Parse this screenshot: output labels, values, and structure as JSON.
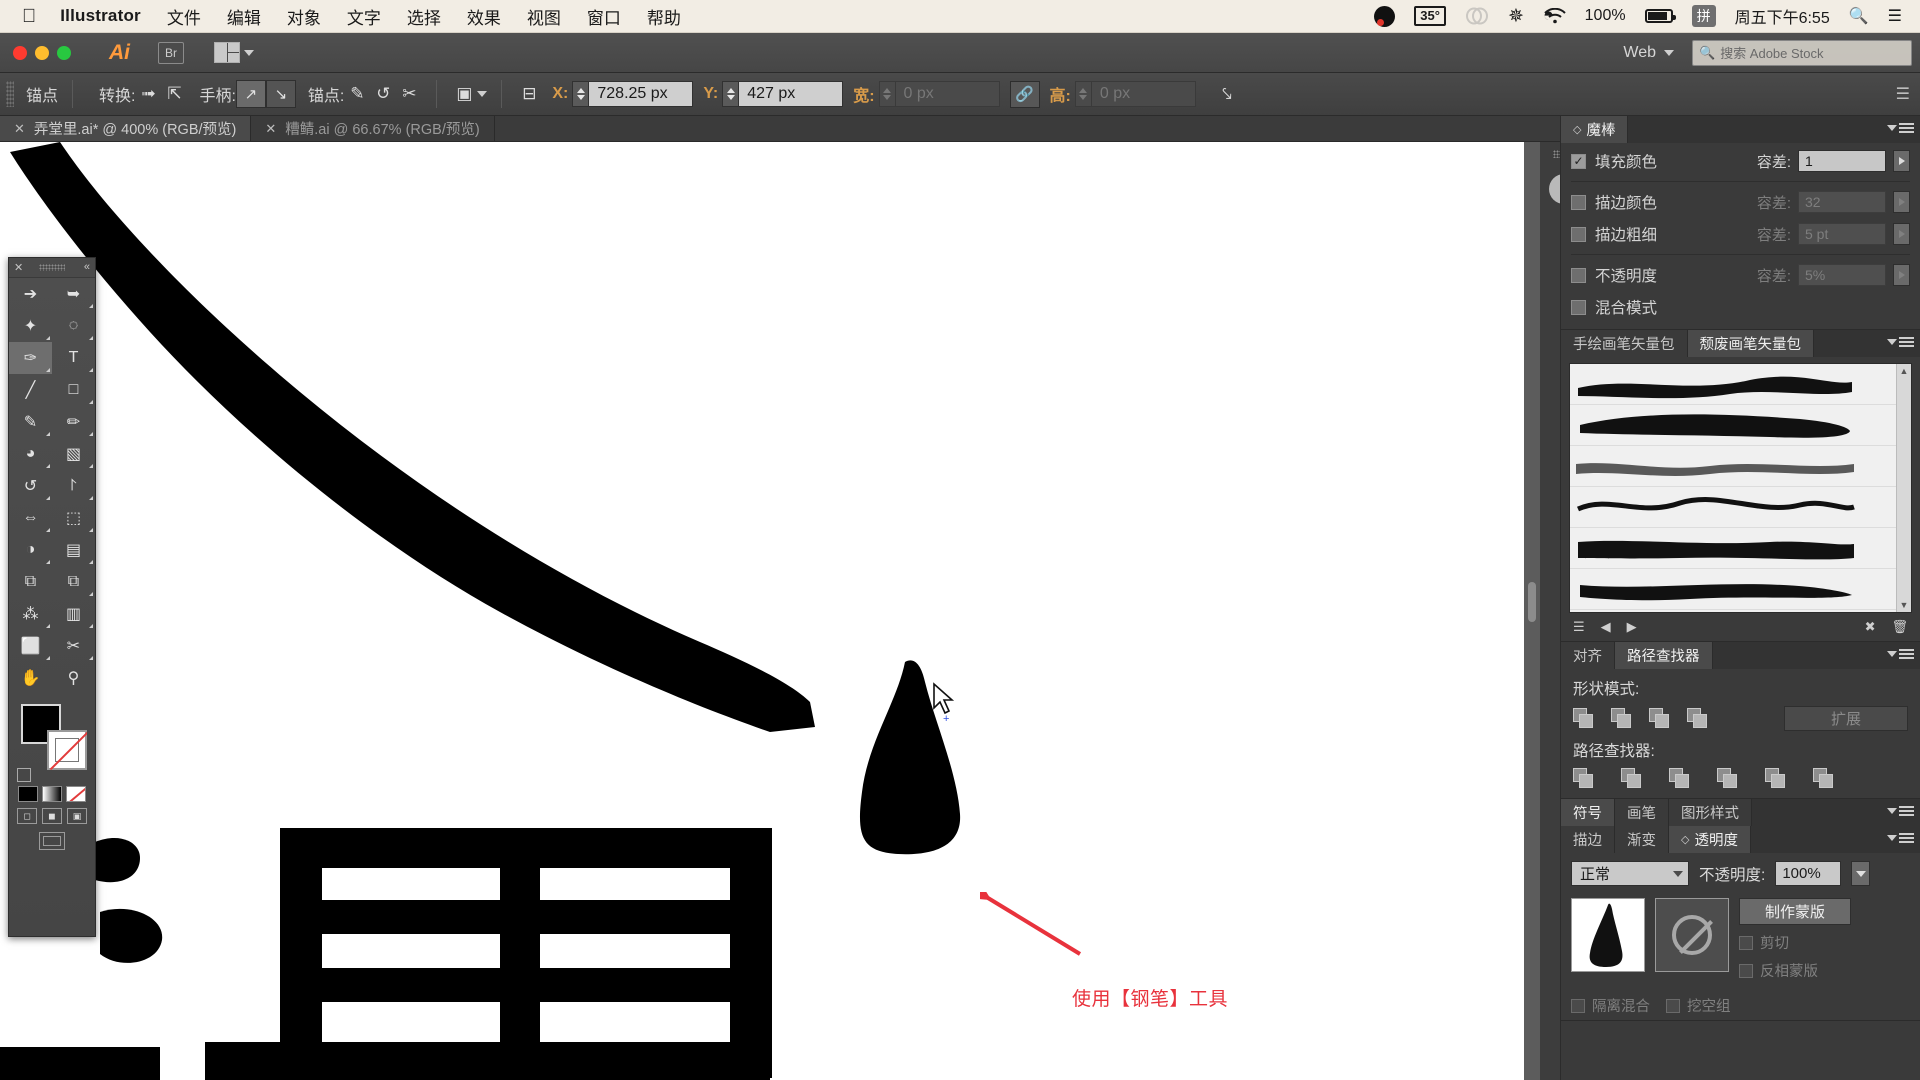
{
  "macbar": {
    "apple_icon": "apple-icon",
    "app_name": "Illustrator",
    "menus": [
      "文件",
      "编辑",
      "对象",
      "文字",
      "选择",
      "效果",
      "视图",
      "窗口",
      "帮助"
    ],
    "status": {
      "obs_icon": "obs-record-icon",
      "temperature": "35°",
      "creative_cloud_icon": "creative-cloud-icon",
      "bluetooth_icon": "bluetooth-icon",
      "wifi_icon": "wifi-icon",
      "battery_percent": "100%",
      "battery_icon": "battery-charging-icon",
      "ime": "拼",
      "clock": "周五下午6:55",
      "spotlight_icon": "search-icon",
      "control_center_icon": "menu-list-icon"
    }
  },
  "titlebar": {
    "logo": "Ai",
    "bridge_button": "Br",
    "arrange_button_label": "arrange-documents",
    "workspace": "Web",
    "search_placeholder": "搜索 Adobe Stock"
  },
  "controlbar": {
    "selection_label": "锚点",
    "convert_label": "转换:",
    "convert_icons": [
      "convert-to-corner-icon",
      "convert-to-smooth-icon"
    ],
    "handles_label": "手柄:",
    "handle_icons": [
      "show-handles-icon",
      "hide-handles-icon"
    ],
    "anchors_label": "锚点:",
    "anchor_icons": [
      "remove-anchor-icon",
      "connect-anchor-icon",
      "cut-path-icon"
    ],
    "isolate_icon": "isolate-selected-icon",
    "align_icon": "align-icon",
    "x_label": "X:",
    "x_value": "728.25 px",
    "y_label": "Y:",
    "y_value": "427 px",
    "w_label": "宽:",
    "w_value": "0 px",
    "h_label": "高:",
    "h_value": "0 px",
    "link_icon": "link-dimensions-icon",
    "transform_icon": "transform-each-icon"
  },
  "tabs": [
    {
      "title": "弄堂里.ai* @ 400% (RGB/预览)",
      "active": true,
      "close_icon": "close-icon"
    },
    {
      "title": "糟鲭.ai @ 66.67% (RGB/预览)",
      "active": false,
      "close_icon": "close-icon"
    }
  ],
  "canvas": {
    "annotation": "使用【钢笔】工具",
    "annotation_color": "#e8323c",
    "arrow_icon": "red-arrow-icon",
    "cursor_icon": "pen-tool-cursor-icon"
  },
  "toolbox": {
    "close_icon": "close-icon",
    "collapse_icon": "double-arrow-icon",
    "tools": [
      {
        "name": "selection-tool",
        "glyph": "↖"
      },
      {
        "name": "direct-selection-tool",
        "glyph": "↖"
      },
      {
        "name": "magic-wand-tool",
        "glyph": "✦"
      },
      {
        "name": "lasso-tool",
        "glyph": "◌"
      },
      {
        "name": "pen-tool",
        "glyph": "✑",
        "selected": true
      },
      {
        "name": "type-tool",
        "glyph": "T"
      },
      {
        "name": "line-segment-tool",
        "glyph": "╱"
      },
      {
        "name": "rectangle-tool",
        "glyph": "□"
      },
      {
        "name": "paintbrush-tool",
        "glyph": "✎"
      },
      {
        "name": "pencil-tool",
        "glyph": "✒"
      },
      {
        "name": "blob-brush-tool",
        "glyph": "◕"
      },
      {
        "name": "eraser-tool",
        "glyph": "◧"
      },
      {
        "name": "rotate-tool",
        "glyph": "↺"
      },
      {
        "name": "scale-tool",
        "glyph": "⤡"
      },
      {
        "name": "width-tool",
        "glyph": "⇔"
      },
      {
        "name": "free-transform-tool",
        "glyph": "⬚"
      },
      {
        "name": "shape-builder-tool",
        "glyph": "◑"
      },
      {
        "name": "gradient-tool",
        "glyph": "▤"
      },
      {
        "name": "eyedropper-tool",
        "glyph": "⚗"
      },
      {
        "name": "blend-tool",
        "glyph": "⧉"
      },
      {
        "name": "symbol-sprayer-tool",
        "glyph": "⁂"
      },
      {
        "name": "column-graph-tool",
        "glyph": "▥"
      },
      {
        "name": "artboard-tool",
        "glyph": "⬜"
      },
      {
        "name": "slice-tool",
        "glyph": "✂"
      },
      {
        "name": "hand-tool",
        "glyph": "✋"
      },
      {
        "name": "zoom-tool",
        "glyph": "⚲"
      }
    ],
    "fill_color": "#000000",
    "stroke_color": "#ffffff",
    "swatch_row": [
      "color-swatch",
      "gradient-swatch",
      "none-swatch"
    ],
    "draw_modes": [
      "draw-normal",
      "draw-behind",
      "draw-inside"
    ],
    "screen_mode": "change-screen-mode"
  },
  "icondock": {
    "info_icon": "info-panel-icon"
  },
  "panels": {
    "magicwand": {
      "tab_label": "魔棒",
      "rows": [
        {
          "label": "填充颜色",
          "checked": true,
          "tol_label": "容差:",
          "tol_value": "1",
          "dim": false
        },
        {
          "label": "描边颜色",
          "checked": false,
          "tol_label": "容差:",
          "tol_value": "32",
          "dim": true
        },
        {
          "label": "描边粗细",
          "checked": false,
          "tol_label": "容差:",
          "tol_value": "5 pt",
          "dim": true
        },
        {
          "label": "不透明度",
          "checked": false,
          "tol_label": "容差:",
          "tol_value": "5%",
          "dim": true
        },
        {
          "label": "混合模式",
          "checked": false,
          "tol_label": "",
          "tol_value": "",
          "dim": true
        }
      ]
    },
    "brushes": {
      "tabs": [
        {
          "label": "手绘画笔矢量包",
          "active": false
        },
        {
          "label": "颓废画笔矢量包",
          "active": true
        }
      ],
      "items": [
        "brush-stroke-1",
        "brush-stroke-2",
        "brush-stroke-3",
        "brush-stroke-4",
        "brush-stroke-5",
        "brush-stroke-6"
      ],
      "footer_icons": [
        "brush-library-icon",
        "prev-icon",
        "next-icon",
        "remove-brush-link-icon",
        "delete-brush-icon"
      ]
    },
    "pathfinder": {
      "tabs": [
        {
          "label": "对齐",
          "active": false
        },
        {
          "label": "路径查找器",
          "active": true
        }
      ],
      "shape_modes_label": "形状模式:",
      "shape_modes": [
        "unite-icon",
        "minus-front-icon",
        "intersect-icon",
        "exclude-icon"
      ],
      "expand_label": "扩展",
      "pathfinders_label": "路径查找器:",
      "pathfinders": [
        "divide-icon",
        "trim-icon",
        "merge-icon",
        "crop-icon",
        "outline-icon",
        "minus-back-icon"
      ]
    },
    "symbols": {
      "tabs": [
        {
          "label": "符号",
          "active": true
        },
        {
          "label": "画笔",
          "active": false
        },
        {
          "label": "图形样式",
          "active": false
        }
      ]
    },
    "transparency": {
      "tabs": [
        {
          "label": "描边",
          "active": false
        },
        {
          "label": "渐变",
          "active": false
        },
        {
          "label": "透明度",
          "active": true
        }
      ],
      "blend_mode": "正常",
      "opacity_label": "不透明度:",
      "opacity_value": "100%",
      "thumbnail_icon": "artwork-thumbnail",
      "mask_thumbnail_icon": "no-mask-icon",
      "make_mask_label": "制作蒙版",
      "clip_label": "剪切",
      "invert_mask_label": "反相蒙版",
      "bottom_options": [
        "隔离混合",
        "挖空组"
      ]
    }
  }
}
